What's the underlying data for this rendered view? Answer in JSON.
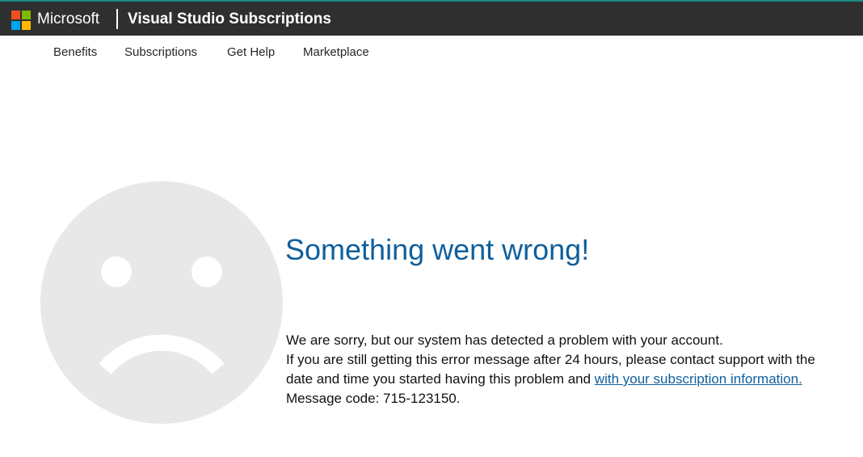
{
  "header": {
    "brand": "Microsoft",
    "product": "Visual Studio Subscriptions",
    "logo_icon": "microsoft-logo-icon",
    "logo_colors": [
      "#f25022",
      "#7fba00",
      "#00a4ef",
      "#ffb900"
    ],
    "bar_color": "#2f2f2f",
    "accent_border": "#1a8a86"
  },
  "nav": {
    "items": [
      {
        "label": "Benefits"
      },
      {
        "label": "Subscriptions"
      },
      {
        "label": "Get Help"
      },
      {
        "label": "Marketplace"
      }
    ]
  },
  "error": {
    "icon": "sad-face-icon",
    "title": "Something went wrong!",
    "line1": "We are sorry, but our system has detected a problem with your account.",
    "line2": "If you are still getting this error message after 24 hours, please contact support with the",
    "line3_prefix": "date and time you started having this problem and ",
    "line3_link": "with your subscription information.",
    "message_code": "Message code: 715-123150.",
    "title_color": "#0e5f9c"
  }
}
